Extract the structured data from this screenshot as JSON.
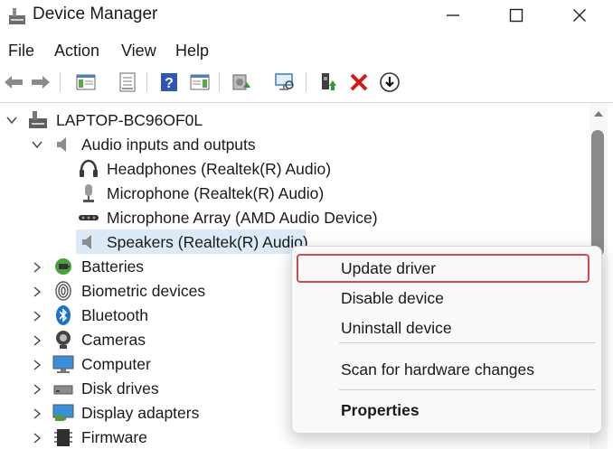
{
  "window": {
    "title": "Device Manager",
    "controls": [
      "minimize",
      "maximize",
      "close"
    ]
  },
  "menu": [
    "File",
    "Action",
    "View",
    "Help"
  ],
  "toolbar": {
    "buttons": [
      "back-arrow-icon",
      "forward-arrow-icon",
      "show-hide-console-tree-icon",
      "properties-sheet-icon",
      "help-icon",
      "action-pane-icon",
      "update-driver-icon",
      "scan-hardware-icon",
      "enable-device-icon",
      "uninstall-device-icon",
      "download-icon"
    ]
  },
  "tree": {
    "root": "LAPTOP-BC96OF0L",
    "expanded_category": "Audio inputs and outputs",
    "audio_devices": [
      "Headphones (Realtek(R) Audio)",
      "Microphone (Realtek(R) Audio)",
      "Microphone Array (AMD Audio Device)",
      "Speakers (Realtek(R) Audio)"
    ],
    "selected_device": "Speakers (Realtek(R) Audio)",
    "categories": [
      "Batteries",
      "Biometric devices",
      "Bluetooth",
      "Cameras",
      "Computer",
      "Disk drives",
      "Display adapters",
      "Firmware"
    ]
  },
  "context_menu": {
    "items": [
      "Update driver",
      "Disable device",
      "Uninstall device",
      "Scan for hardware changes",
      "Properties"
    ],
    "highlighted": "Update driver",
    "highlight_color": "#d2494a"
  },
  "colors": {
    "selection": "#dce9f7",
    "accent_blue": "#1a73c8",
    "uninstall_red": "#d11a1a"
  }
}
